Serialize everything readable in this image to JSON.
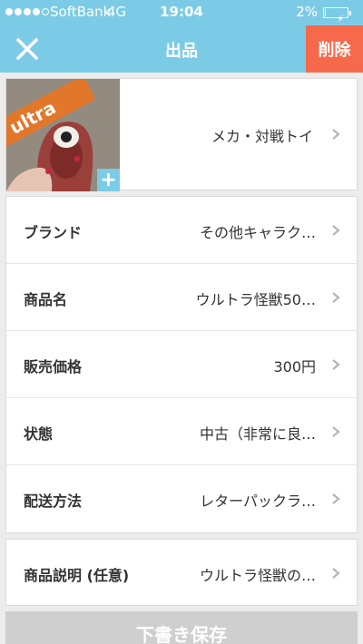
{
  "status_bar": {
    "carrier": "SoftBank",
    "network": "4G",
    "time": "19:04",
    "battery_percent": "2%",
    "battery_level": 0.02,
    "signal_bars": 4
  },
  "nav": {
    "title": "出品",
    "close_icon": "close-icon",
    "delete_label": "削除"
  },
  "product": {
    "category": "メカ・対戦トイ",
    "add_photo_symbol": "+",
    "photo_logo_text": "ultra"
  },
  "fields": [
    {
      "label": "ブランド",
      "value": "その他キャラク…"
    },
    {
      "label": "商品名",
      "value": "ウルトラ怪獣50…"
    },
    {
      "label": "販売価格",
      "value": "300円"
    },
    {
      "label": "状態",
      "value": "中古（非常に良…"
    },
    {
      "label": "配送方法",
      "value": "レターパックラ…"
    }
  ],
  "description": {
    "label": "商品説明 (任意)",
    "value": "ウルトラ怪獣の…"
  },
  "footer": {
    "draft_button": "下書き保存"
  },
  "colors": {
    "header": "#7ccbe6",
    "delete": "#f66a4b",
    "draft_disabled": "#cfcfcf"
  }
}
